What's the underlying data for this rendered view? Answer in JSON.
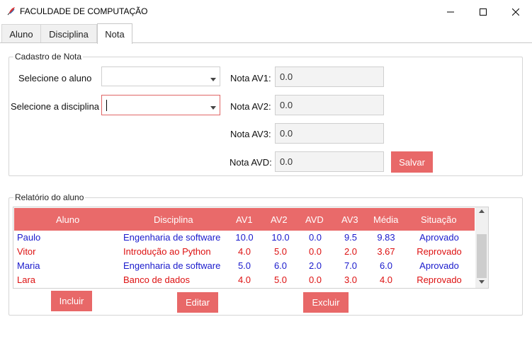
{
  "window": {
    "title": "FACULDADE DE COMPUTAÇÃO",
    "minimize_icon": "minimize-icon",
    "maximize_icon": "maximize-icon",
    "close_icon": "close-icon"
  },
  "tabs": [
    {
      "label": "Aluno",
      "active": false
    },
    {
      "label": "Disciplina",
      "active": false
    },
    {
      "label": "Nota",
      "active": true
    }
  ],
  "cadastro": {
    "legend": "Cadastro de Nota",
    "aluno_label": "Selecione o aluno",
    "aluno_value": "",
    "disciplina_label": "Selecione a disciplina",
    "disciplina_value": "",
    "av1_label": "Nota AV1:",
    "av1_value": "0.0",
    "av2_label": "Nota AV2:",
    "av2_value": "0.0",
    "av3_label": "Nota AV3:",
    "av3_value": "0.0",
    "avd_label": "Nota AVD:",
    "avd_value": "0.0",
    "save_label": "Salvar"
  },
  "relatorio": {
    "legend": "Relatório do aluno",
    "columns": [
      "Aluno",
      "Disciplina",
      "AV1",
      "AV2",
      "AVD",
      "AV3",
      "Média",
      "Situação"
    ],
    "rows": [
      {
        "aluno": "Paulo",
        "disciplina": "Engenharia de software",
        "av1": "10.0",
        "av2": "10.0",
        "avd": "0.0",
        "av3": "9.5",
        "media": "9.83",
        "situacao": "Aprovado",
        "color": "#1a1acc"
      },
      {
        "aluno": "Vitor",
        "disciplina": "Introdução ao Python",
        "av1": "4.0",
        "av2": "5.0",
        "avd": "0.0",
        "av3": "2.0",
        "media": "3.67",
        "situacao": "Reprovado",
        "color": "#dd1111"
      },
      {
        "aluno": "Maria",
        "disciplina": "Engenharia de software",
        "av1": "5.0",
        "av2": "6.0",
        "avd": "2.0",
        "av3": "7.0",
        "media": "6.0",
        "situacao": "Aprovado",
        "color": "#1a1acc"
      },
      {
        "aluno": "Lara",
        "disciplina": "Banco de dados",
        "av1": "4.0",
        "av2": "5.0",
        "avd": "0.0",
        "av3": "3.0",
        "media": "4.0",
        "situacao": "Reprovado",
        "color": "#dd1111"
      }
    ],
    "include_label": "Incluir",
    "edit_label": "Editar",
    "delete_label": "Excluir"
  },
  "colors": {
    "accent": "#e96a6a",
    "approved": "#1a1acc",
    "failed": "#dd1111"
  }
}
